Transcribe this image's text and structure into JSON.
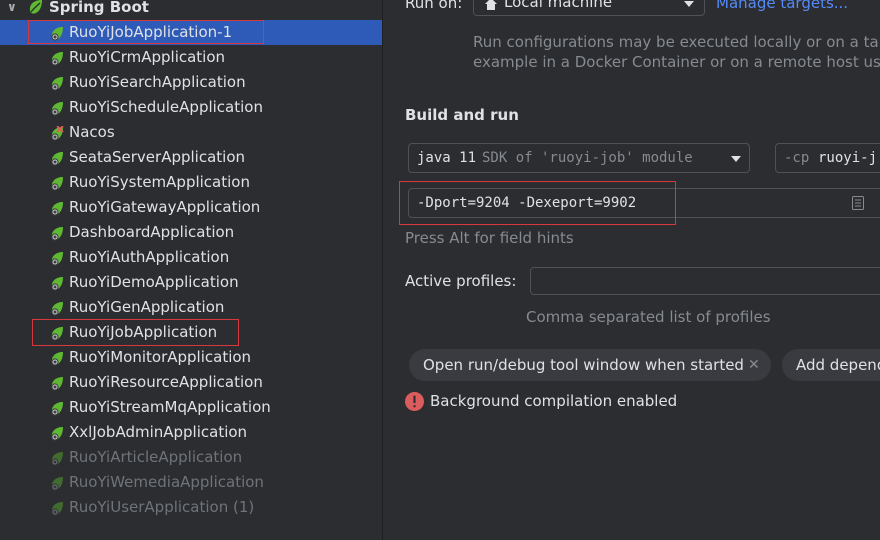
{
  "tree": {
    "root_label": "Spring Boot",
    "items": [
      {
        "label": "RuoYiJobApplication-1",
        "state": "selected"
      },
      {
        "label": "RuoYiCrmApplication",
        "state": "normal"
      },
      {
        "label": "RuoYiSearchApplication",
        "state": "normal"
      },
      {
        "label": "RuoYiScheduleApplication",
        "state": "normal"
      },
      {
        "label": "Nacos",
        "state": "error"
      },
      {
        "label": "SeataServerApplication",
        "state": "normal"
      },
      {
        "label": "RuoYiSystemApplication",
        "state": "normal"
      },
      {
        "label": "RuoYiGatewayApplication",
        "state": "normal"
      },
      {
        "label": "DashboardApplication",
        "state": "normal"
      },
      {
        "label": "RuoYiAuthApplication",
        "state": "normal"
      },
      {
        "label": "RuoYiDemoApplication",
        "state": "normal"
      },
      {
        "label": "RuoYiGenApplication",
        "state": "normal"
      },
      {
        "label": "RuoYiJobApplication",
        "state": "normal"
      },
      {
        "label": "RuoYiMonitorApplication",
        "state": "normal"
      },
      {
        "label": "RuoYiResourceApplication",
        "state": "normal"
      },
      {
        "label": "RuoYiStreamMqApplication",
        "state": "normal"
      },
      {
        "label": "XxlJobAdminApplication",
        "state": "normal"
      },
      {
        "label": "RuoYiArticleApplication",
        "state": "disabled"
      },
      {
        "label": "RuoYiWemediaApplication",
        "state": "disabled"
      },
      {
        "label": "RuoYiUserApplication (1)",
        "state": "disabled"
      }
    ]
  },
  "run_on": {
    "label": "Run on:",
    "value": "Local machine",
    "manage_link": "Manage targets...",
    "hint_line1": "Run configurations may be executed locally or on a targ",
    "hint_line2": "example in a Docker Container or on a remote host using"
  },
  "build_and_run": {
    "heading": "Build and run",
    "sdk_keyword": "java 11",
    "sdk_detail": "SDK of 'ruoyi-job' module",
    "cp_flag": "-cp",
    "cp_value": "ruoyi-j",
    "vm_options": "-Dport=9204 -Dexeport=9902",
    "field_hint": "Press Alt for field hints"
  },
  "profiles": {
    "label": "Active profiles:",
    "value": "",
    "hint": "Comma separated list of profiles"
  },
  "chips": {
    "open_tool_window": "Open run/debug tool window when started",
    "add_dependency": "Add depende"
  },
  "warning": {
    "text": "Background compilation enabled",
    "color": "#db5c5c"
  },
  "colors": {
    "selection": "#2e5bb8",
    "highlight_box": "#d9363e",
    "spring_green": "#5fb832"
  }
}
